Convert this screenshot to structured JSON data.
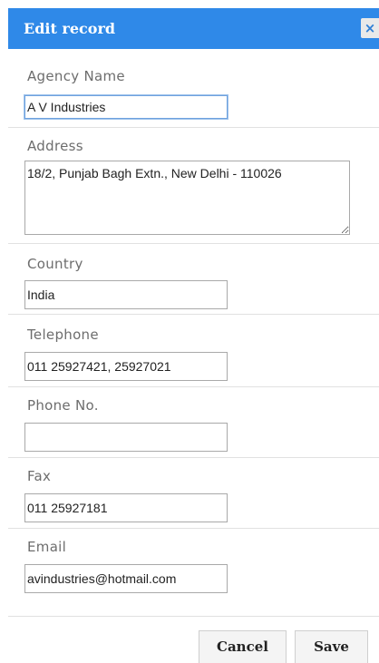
{
  "dialog": {
    "title": "Edit record",
    "close_glyph": "×"
  },
  "fields": {
    "agency_name": {
      "label": "Agency Name",
      "value": "A V Industries"
    },
    "address": {
      "label": "Address",
      "value": "18/2, Punjab Bagh Extn., New Delhi - 110026"
    },
    "country": {
      "label": "Country",
      "value": "India"
    },
    "telephone": {
      "label": "Telephone",
      "value": "011 25927421, 25927021"
    },
    "phone_no": {
      "label": "Phone No.",
      "value": ""
    },
    "fax": {
      "label": "Fax",
      "value": "011 25927181"
    },
    "email": {
      "label": "Email",
      "value": "avindustries@hotmail.com"
    }
  },
  "buttons": {
    "cancel": "Cancel",
    "save": "Save"
  },
  "colors": {
    "titlebar": "#2f89e8",
    "focus_border": "#6fa2de"
  }
}
